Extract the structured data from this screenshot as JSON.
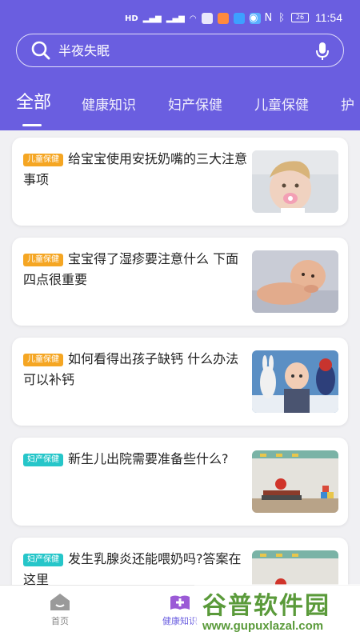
{
  "status_bar": {
    "time": "11:54",
    "battery": "26",
    "icons": [
      "hd-icon",
      "signal-icon",
      "wifi-icon",
      "message-icon",
      "app-icon",
      "eye-icon",
      "nfc-icon",
      "bluetooth-icon",
      "battery-icon"
    ]
  },
  "search": {
    "placeholder": "半夜失眠",
    "icon": "search-icon",
    "mic_icon": "mic-icon"
  },
  "tabs": [
    {
      "label": "全部",
      "active": true
    },
    {
      "label": "健康知识"
    },
    {
      "label": "妇产保健"
    },
    {
      "label": "儿童保健"
    },
    {
      "label": "护"
    }
  ],
  "articles": [
    {
      "tag": "儿童保健",
      "title": "给宝宝使用安抚奶嘴的三大注意事项",
      "image": "baby-pacifier-photo"
    },
    {
      "tag": "儿童保健",
      "title": "宝宝得了湿疹要注意什么 下面四点很重要",
      "image": "baby-lying-photo"
    },
    {
      "tag": "儿童保健",
      "title": "如何看得出孩子缺钙 什么办法可以补钙",
      "image": "child-with-toys-photo"
    },
    {
      "tag": "妇产保健",
      "title": "新生儿出院需要准备些什么?",
      "image": "books-apple-photo"
    },
    {
      "tag": "妇产保健",
      "title": "发生乳腺炎还能喂奶吗?答案在这里",
      "image": "books-apple-photo"
    }
  ],
  "nav": [
    {
      "label": "首页",
      "icon": "home-icon",
      "active": false
    },
    {
      "label": "健康知识",
      "icon": "health-book-icon",
      "active": true
    }
  ],
  "watermark": {
    "text": "谷普软件园",
    "url": "www.gupuxlazal.com"
  },
  "colors": {
    "primary": "#6a5ee0",
    "kid_tag": "#f5a623",
    "mom_tag": "#26c6c9"
  }
}
